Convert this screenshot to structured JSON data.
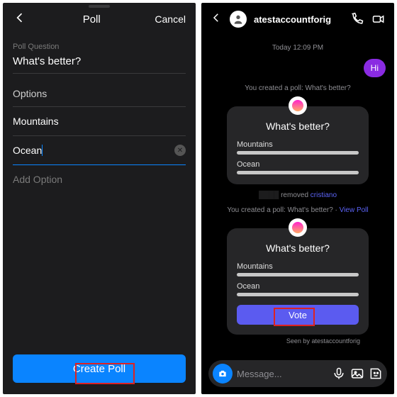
{
  "left": {
    "header": {
      "title": "Poll",
      "cancel": "Cancel"
    },
    "question_label": "Poll Question",
    "question_value": "What's better?",
    "options_header": "Options",
    "options": [
      "Mountains",
      "Ocean"
    ],
    "add_option_placeholder": "Add Option",
    "create_button": "Create Poll"
  },
  "right": {
    "account_name": "atestaccountforig",
    "timestamp": "Today 12:09 PM",
    "greeting": "Hi",
    "system_created": "You created a poll: What's better?",
    "poll1": {
      "question": "What's better?",
      "opt1": "Mountains",
      "opt2": "Ocean"
    },
    "removed_line_suffix": "removed",
    "removed_user": "cristiano",
    "system_created2_prefix": "You created a poll: What's better? ·",
    "view_poll": "View Poll",
    "poll2": {
      "question": "What's better?",
      "opt1": "Mountains",
      "opt2": "Ocean",
      "vote": "Vote"
    },
    "seen_by": "Seen by atestaccountforig",
    "composer_placeholder": "Message..."
  }
}
